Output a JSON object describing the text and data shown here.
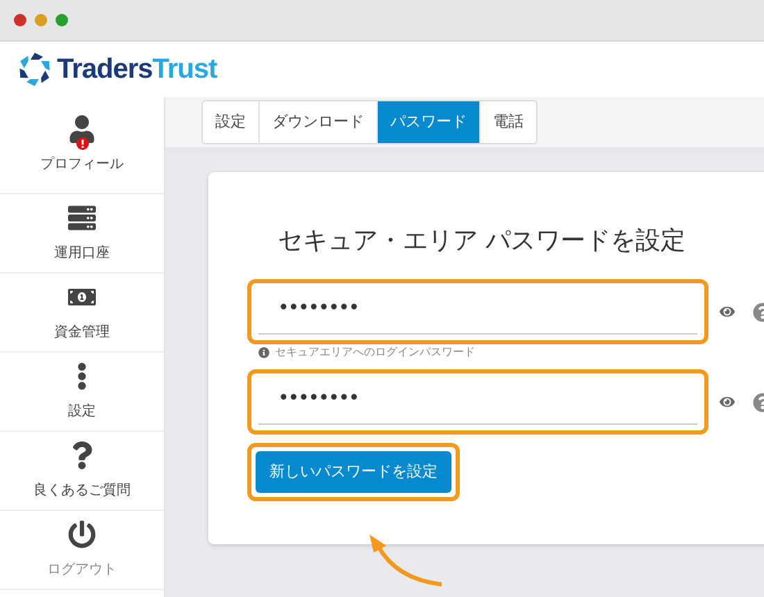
{
  "logo": {
    "parts": [
      "Traders",
      "Trust"
    ]
  },
  "sidebar": {
    "items": [
      {
        "label": "プロフィール",
        "kind": "user",
        "alert": true
      },
      {
        "label": "運用口座",
        "kind": "server",
        "alert": false
      },
      {
        "label": "資金管理",
        "kind": "money",
        "alert": false
      },
      {
        "label": "設定",
        "kind": "dots",
        "alert": false
      },
      {
        "label": "良くあるご質問",
        "kind": "question",
        "alert": false
      },
      {
        "label": "ログアウト",
        "kind": "power",
        "alert": false
      }
    ]
  },
  "tabs": [
    {
      "label": "設定",
      "selected": false
    },
    {
      "label": "ダウンロード",
      "selected": false
    },
    {
      "label": "パスワード",
      "selected": true
    },
    {
      "label": "電話",
      "selected": false
    }
  ],
  "card": {
    "title": "セキュア・エリア パスワードを設定",
    "fields": [
      {
        "value": "••••••••",
        "highlighted": true,
        "hint": "セキュアエリアへのログインパスワード"
      },
      {
        "value": "••••••••",
        "highlighted": true
      }
    ],
    "button": {
      "label": "新しいパスワードを設定",
      "highlighted": true
    }
  }
}
